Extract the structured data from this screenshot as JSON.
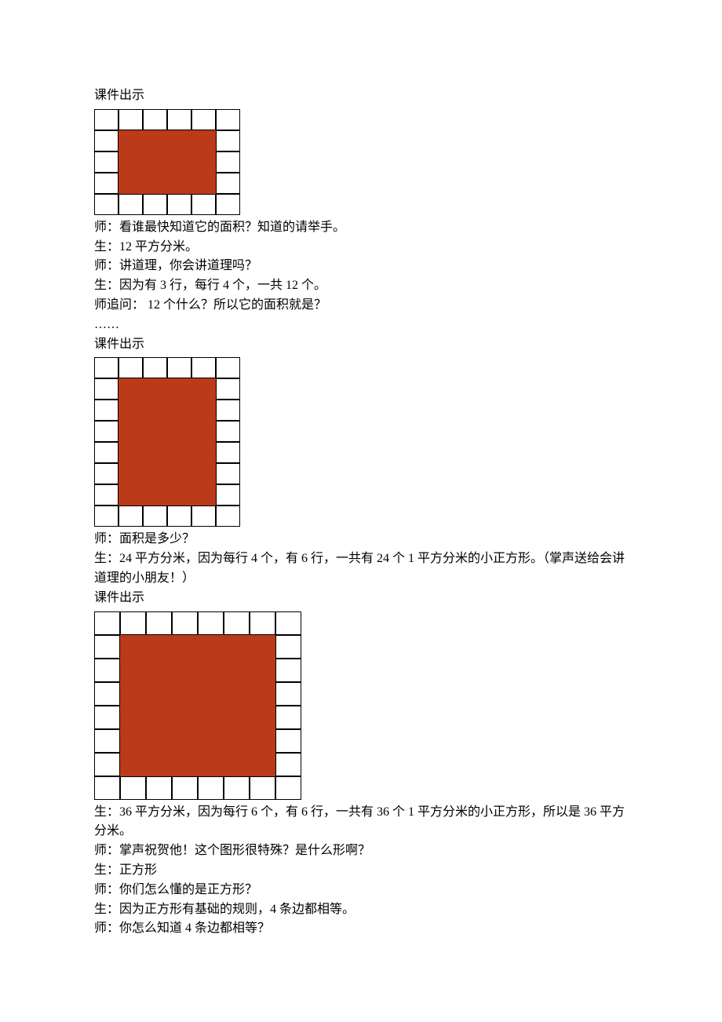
{
  "sec1": {
    "heading": "课件出示",
    "lines": [
      "师：看谁最快知道它的面积？知道的请举手。",
      "生：12 平方分米。",
      "师：讲道理，你会讲道理吗？",
      "生：因为有 3 行，每行 4 个，一共 12 个。",
      "师追问：  12 个什么？所以它的面积就是？",
      "……"
    ]
  },
  "sec2": {
    "heading": "课件出示",
    "lines": [
      "师：面积是多少？",
      "生：24 平方分米，因为每行 4 个，有 6 行，一共有 24 个 1 平方分米的小正方形。（掌声送给会讲道理的小朋友！）"
    ]
  },
  "sec3": {
    "heading": "课件出示",
    "lines": [
      "生：36 平方分米，因为每行 6 个，有 6 行，一共有 36 个 1 平方分米的小正方形，所以是 36 平方分米。",
      "师：掌声祝贺他！这个图形很特殊？是什么形啊？",
      "生：正方形",
      "师：你们怎么懂的是正方形？",
      "生：因为正方形有基础的规则，4 条边都相等。",
      "师：你怎么知道 4 条边都相等？"
    ]
  },
  "diagram1": {
    "cols": 6,
    "rows": 5,
    "inner_cols": 4,
    "inner_rows": 3
  },
  "diagram2": {
    "cols": 6,
    "rows": 8,
    "inner_cols": 4,
    "inner_rows": 6
  },
  "diagram3": {
    "cols": 8,
    "rows": 8,
    "inner_cols": 6,
    "inner_rows": 6
  },
  "colors": {
    "fill": "#bb3a19",
    "grid_border": "#000000"
  }
}
